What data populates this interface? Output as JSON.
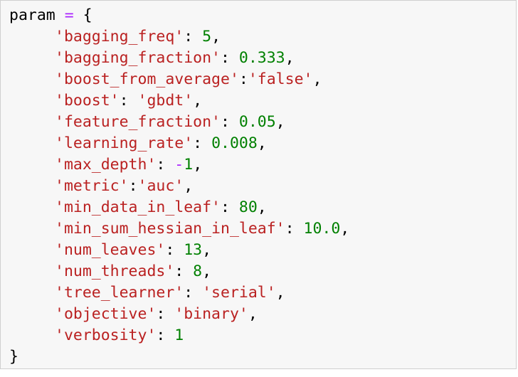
{
  "code": {
    "variable": "param",
    "assign_op": "=",
    "open_brace": "{",
    "close_brace": "}",
    "entries": [
      {
        "key": "'bagging_freq'",
        "sep": ": ",
        "value": "5",
        "value_type": "num",
        "trail": ","
      },
      {
        "key": "'bagging_fraction'",
        "sep": ": ",
        "value": "0.333",
        "value_type": "num",
        "trail": ","
      },
      {
        "key": "'boost_from_average'",
        "sep": ":",
        "value": "'false'",
        "value_type": "str",
        "trail": ","
      },
      {
        "key": "'boost'",
        "sep": ": ",
        "value": "'gbdt'",
        "value_type": "str",
        "trail": ","
      },
      {
        "key": "'feature_fraction'",
        "sep": ": ",
        "value": "0.05",
        "value_type": "num",
        "trail": ","
      },
      {
        "key": "'learning_rate'",
        "sep": ": ",
        "value": "0.008",
        "value_type": "num",
        "trail": ","
      },
      {
        "key": "'max_depth'",
        "sep": ": ",
        "neg": "-",
        "value": "1",
        "value_type": "num",
        "trail": ","
      },
      {
        "key": "'metric'",
        "sep": ":",
        "value": "'auc'",
        "value_type": "str",
        "trail": ","
      },
      {
        "key": "'min_data_in_leaf'",
        "sep": ": ",
        "value": "80",
        "value_type": "num",
        "trail": ","
      },
      {
        "key": "'min_sum_hessian_in_leaf'",
        "sep": ": ",
        "value": "10.0",
        "value_type": "num",
        "trail": ","
      },
      {
        "key": "'num_leaves'",
        "sep": ": ",
        "value": "13",
        "value_type": "num",
        "trail": ","
      },
      {
        "key": "'num_threads'",
        "sep": ": ",
        "value": "8",
        "value_type": "num",
        "trail": ","
      },
      {
        "key": "'tree_learner'",
        "sep": ": ",
        "value": "'serial'",
        "value_type": "str",
        "trail": ","
      },
      {
        "key": "'objective'",
        "sep": ": ",
        "value": "'binary'",
        "value_type": "str",
        "trail": ","
      },
      {
        "key": "'verbosity'",
        "sep": ": ",
        "value": "1",
        "value_type": "num",
        "trail": ""
      }
    ]
  },
  "colors": {
    "string": "#ba2121",
    "number": "#008000",
    "operator": "#aa22ff",
    "text": "#000000",
    "cell_background": "#f7f7f7",
    "cell_border": "#cfcfcf"
  }
}
